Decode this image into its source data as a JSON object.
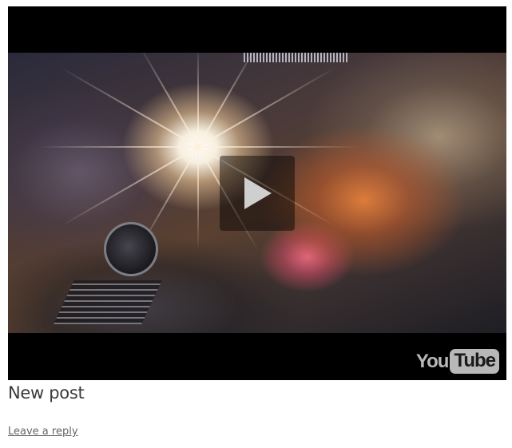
{
  "video": {
    "provider": "YouTube",
    "logo": {
      "you": "You",
      "tube": "Tube"
    },
    "play_icon": "play-icon"
  },
  "post": {
    "title": "New post",
    "reply_link": "Leave a reply"
  },
  "colors": {
    "title_text": "#3a3a3a",
    "link_text": "#666666",
    "player_background": "#000000",
    "logo_gray": "#b8b8b8"
  }
}
